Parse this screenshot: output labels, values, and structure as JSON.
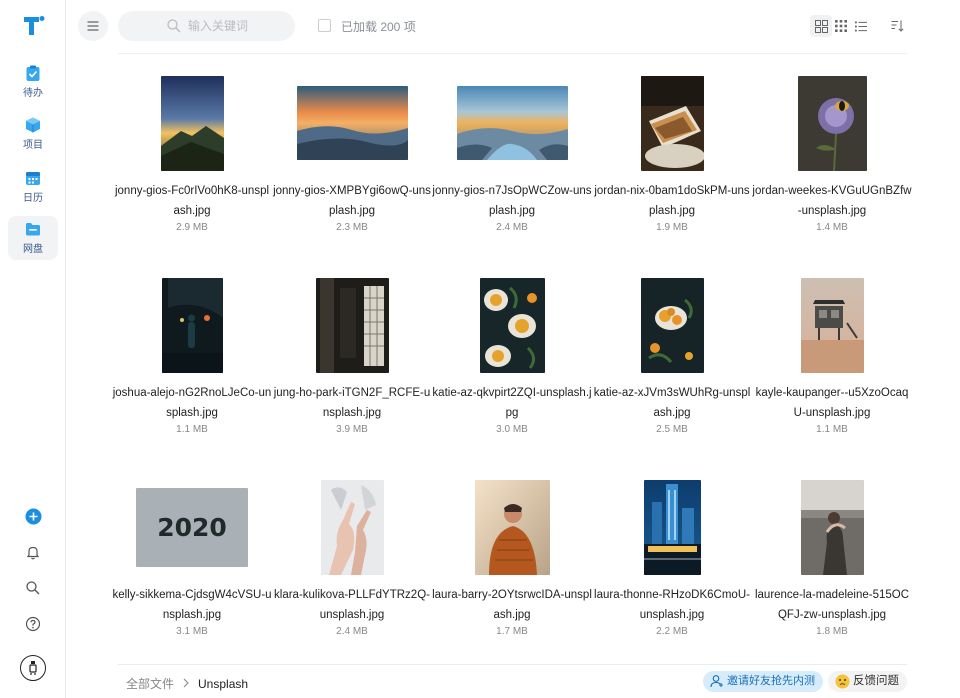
{
  "nav": {
    "items": [
      {
        "label": "待办"
      },
      {
        "label": "项目"
      },
      {
        "label": "日历"
      },
      {
        "label": "网盘"
      }
    ]
  },
  "toolbar": {
    "search_placeholder": "输入关键词",
    "loaded_label": "已加载 200 项"
  },
  "files": [
    {
      "name": "jonny-gios-Fc0rIVo0hK8-unsplash.jpg",
      "size": "2.9 MB"
    },
    {
      "name": "jonny-gios-XMPBYgi6owQ-unsplash.jpg",
      "size": "2.3 MB"
    },
    {
      "name": "jonny-gios-n7JsOpWCZow-unsplash.jpg",
      "size": "2.4 MB"
    },
    {
      "name": "jordan-nix-0bam1doSkPM-unsplash.jpg",
      "size": "1.9 MB"
    },
    {
      "name": "jordan-weekes-KVGuUGnBZfw-unsplash.jpg",
      "size": "1.4 MB"
    },
    {
      "name": "joshua-alejo-nG2RnoLJeCo-unsplash.jpg",
      "size": "1.1 MB"
    },
    {
      "name": "jung-ho-park-iTGN2F_RCFE-unsplash.jpg",
      "size": "3.9 MB"
    },
    {
      "name": "katie-az-qkvpirt2ZQI-unsplash.jpg",
      "size": "3.0 MB"
    },
    {
      "name": "katie-az-xJVm3sWUhRg-unsplash.jpg",
      "size": "2.5 MB"
    },
    {
      "name": "kayle-kaupanger--u5XzoOcaqU-unsplash.jpg",
      "size": "1.1 MB"
    },
    {
      "name": "kelly-sikkema-CjdsgW4cVSU-unsplash.jpg",
      "size": "3.1 MB",
      "thumb_text": "2020"
    },
    {
      "name": "klara-kulikova-PLLFdYTRz2Q-unsplash.jpg",
      "size": "2.4 MB"
    },
    {
      "name": "laura-barry-2OYtsrwcIDA-unsplash.jpg",
      "size": "1.7 MB"
    },
    {
      "name": "laura-thonne-RHzoDK6CmoU-unsplash.jpg",
      "size": "2.2 MB"
    },
    {
      "name": "laurence-la-madeleine-515OCQFJ-zw-unsplash.jpg",
      "size": "1.8 MB"
    }
  ],
  "breadcrumb": {
    "root": "全部文件",
    "current": "Unsplash"
  },
  "footer": {
    "invite_label": "邀请好友抢先内测",
    "feedback_label": "反馈问题"
  },
  "colors": {
    "brand": "#1a8fe0",
    "add_button": "#1a8fe0",
    "invite_bg": "#d6ecfb"
  }
}
